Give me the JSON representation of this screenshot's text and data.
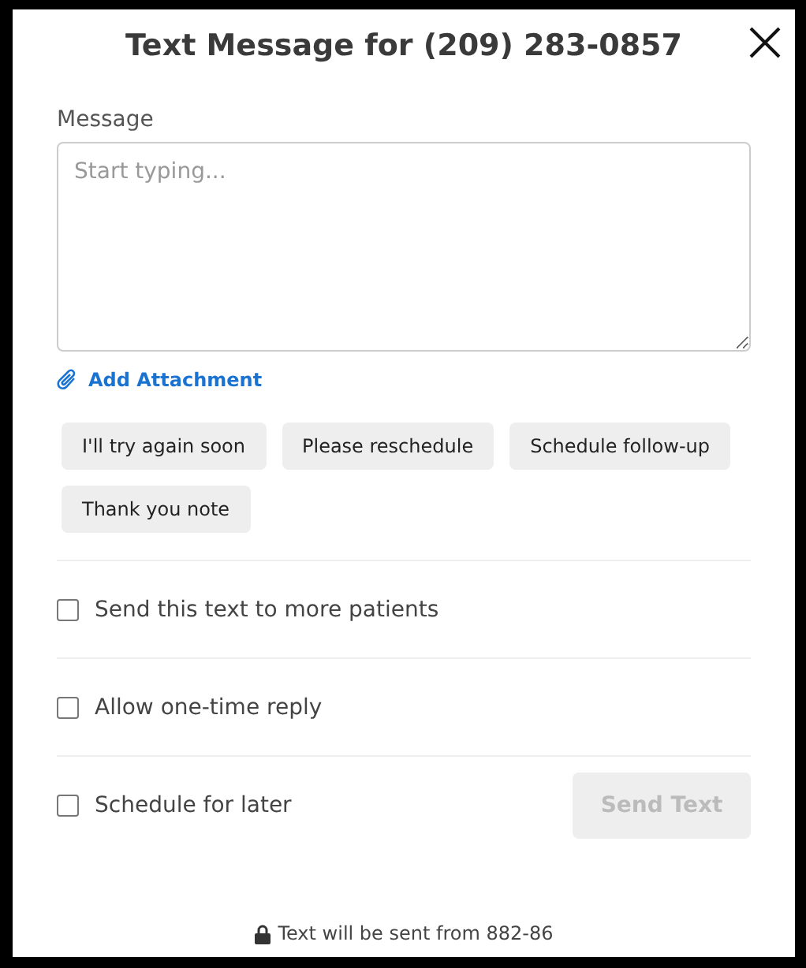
{
  "dialog": {
    "title": "Text Message for (209) 283-0857"
  },
  "message": {
    "label": "Message",
    "placeholder": "Start typing..."
  },
  "attachment_link": "Add Attachment",
  "quick_replies": [
    {
      "label": "I'll try again soon"
    },
    {
      "label": "Please reschedule"
    },
    {
      "label": "Schedule follow-up"
    },
    {
      "label": "Thank you note"
    }
  ],
  "options": [
    {
      "label": "Send this text to more patients",
      "checked": false
    },
    {
      "label": "Allow one-time reply",
      "checked": false
    },
    {
      "label": "Schedule for later",
      "checked": false
    }
  ],
  "send_button": {
    "label": "Send Text",
    "disabled": true
  },
  "footer": "Text will be sent from 882-86"
}
